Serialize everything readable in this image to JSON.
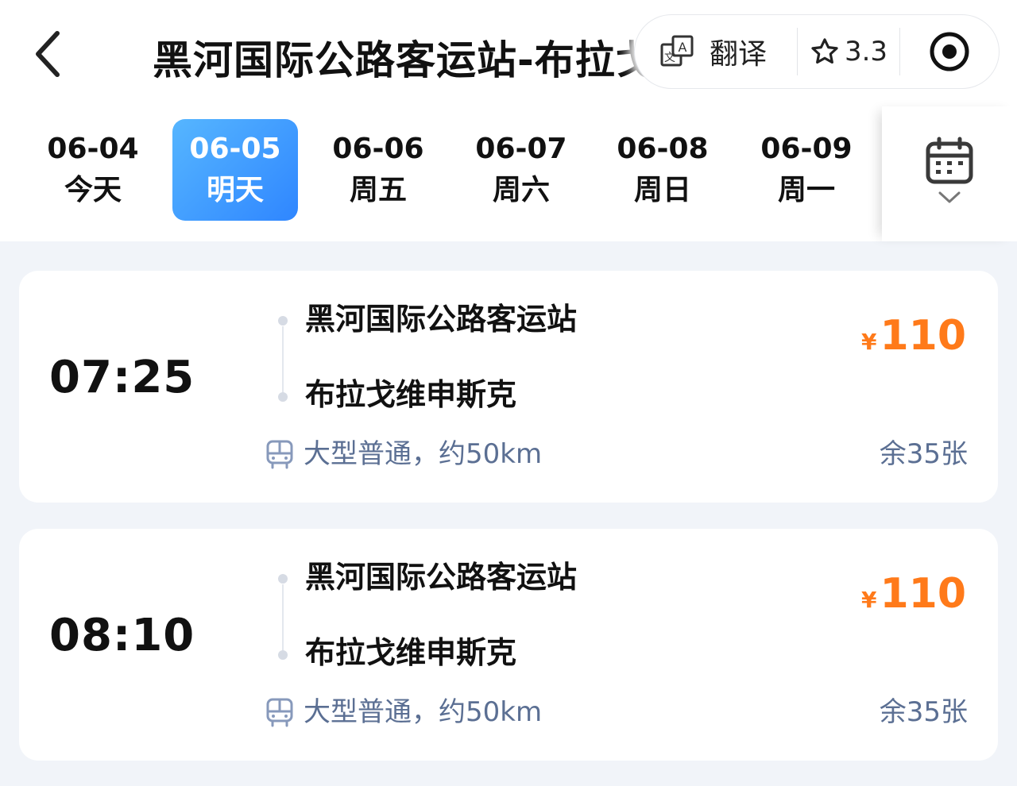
{
  "header": {
    "title": "黑河国际公路客运站-布拉戈维申斯克",
    "translate_label": "翻译",
    "rating": "3.3"
  },
  "dates": [
    {
      "date": "06-04",
      "day": "今天",
      "selected": false
    },
    {
      "date": "06-05",
      "day": "明天",
      "selected": true
    },
    {
      "date": "06-06",
      "day": "周五",
      "selected": false
    },
    {
      "date": "06-07",
      "day": "周六",
      "selected": false
    },
    {
      "date": "06-08",
      "day": "周日",
      "selected": false
    },
    {
      "date": "06-09",
      "day": "周一",
      "selected": false
    }
  ],
  "trips": [
    {
      "time": "07:25",
      "from": "黑河国际公路客运站",
      "to": "布拉戈维申斯克",
      "currency": "¥",
      "price": "110",
      "bus_info": "大型普通，约50km",
      "seats": "余35张"
    },
    {
      "time": "08:10",
      "from": "黑河国际公路客运站",
      "to": "布拉戈维申斯克",
      "currency": "¥",
      "price": "110",
      "bus_info": "大型普通，约50km",
      "seats": "余35张"
    }
  ],
  "colors": {
    "accent": "#2f86ff",
    "price": "#ff7a1a",
    "muted": "#5b6f93",
    "background": "#f1f4f9"
  },
  "icons": {
    "back": "back-chevron-icon",
    "translate": "translate-icon",
    "rating": "star-outline-icon",
    "record": "record-target-icon",
    "calendar": "calendar-icon",
    "calendar_expand": "chevron-down-icon",
    "bus": "bus-icon"
  }
}
